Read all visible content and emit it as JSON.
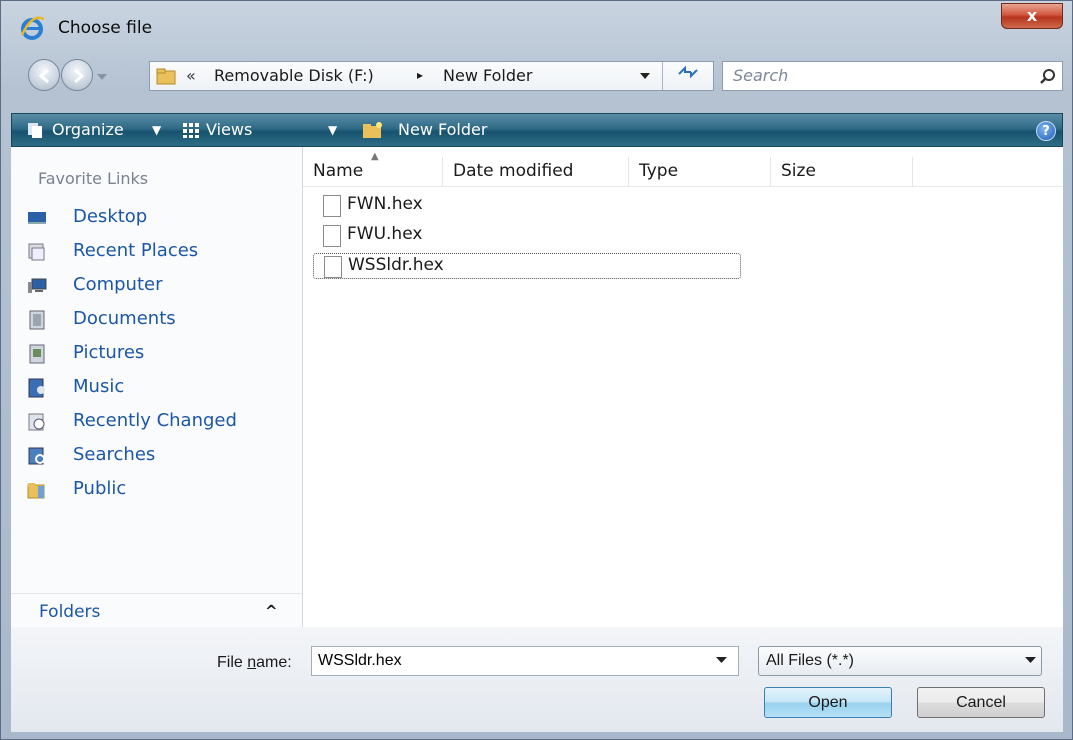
{
  "window": {
    "title": "Choose file",
    "close_label": "x"
  },
  "address": {
    "overflow": "«",
    "crumbs": [
      "Removable Disk (F:)",
      "New Folder"
    ],
    "separator": "▸"
  },
  "search": {
    "placeholder": "Search"
  },
  "toolbar": {
    "organize": "Organize",
    "views": "Views",
    "new_folder": "New Folder",
    "help": "?"
  },
  "favorites": {
    "heading": "Favorite Links",
    "items": [
      {
        "label": "Desktop",
        "icon": "desktop-icon"
      },
      {
        "label": "Recent Places",
        "icon": "recent-places-icon"
      },
      {
        "label": "Computer",
        "icon": "computer-icon"
      },
      {
        "label": "Documents",
        "icon": "documents-icon"
      },
      {
        "label": "Pictures",
        "icon": "pictures-icon"
      },
      {
        "label": "Music",
        "icon": "music-icon"
      },
      {
        "label": "Recently Changed",
        "icon": "recently-changed-icon"
      },
      {
        "label": "Searches",
        "icon": "searches-icon"
      },
      {
        "label": "Public",
        "icon": "public-folder-icon"
      }
    ],
    "folders_label": "Folders"
  },
  "columns": [
    "Name",
    "Date modified",
    "Type",
    "Size"
  ],
  "files": [
    {
      "name": "FWN.hex"
    },
    {
      "name": "FWU.hex"
    },
    {
      "name": "WSSldr.hex",
      "selected": true
    }
  ],
  "bottom": {
    "file_name_label_pre": "File ",
    "file_name_label_u": "n",
    "file_name_label_post": "ame:",
    "file_name_value": "WSSldr.hex",
    "file_type": "All Files (*.*)",
    "open_label": "Open",
    "cancel_label": "Cancel"
  },
  "colors": {
    "toolbar": "#2f6a86",
    "link": "#1c56a7"
  }
}
